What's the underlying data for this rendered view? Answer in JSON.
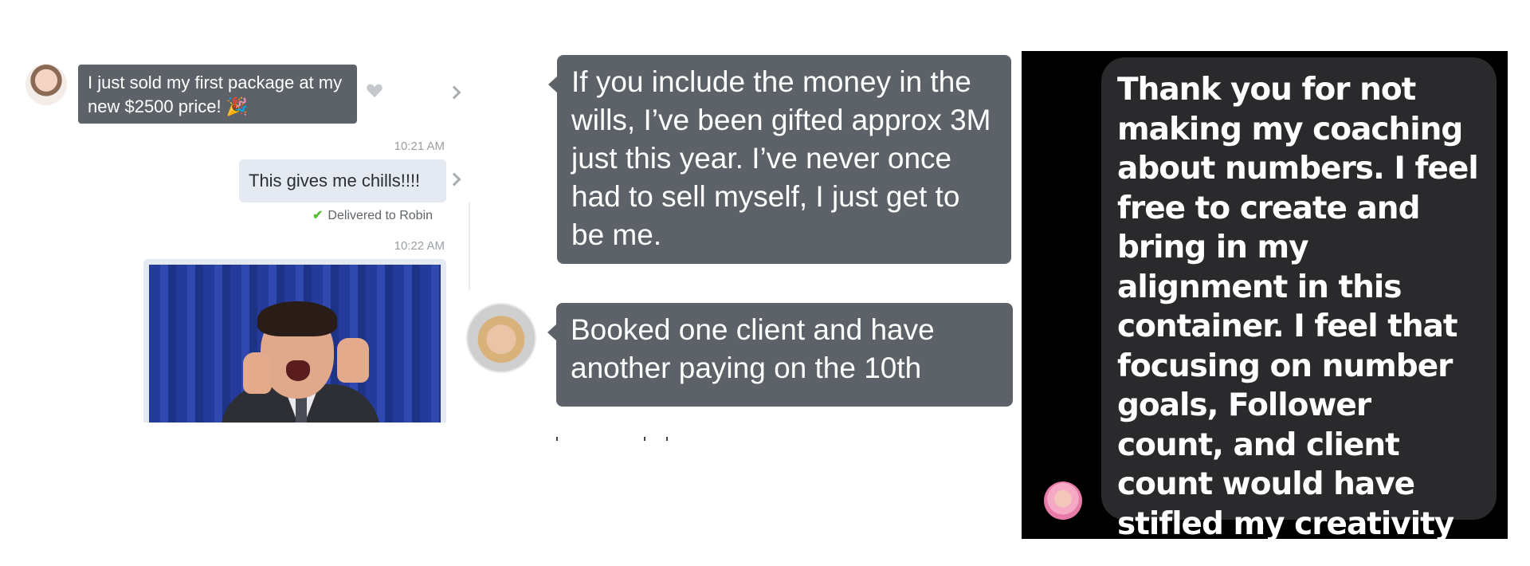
{
  "left_chat": {
    "incoming_message": "I just sold my first package at my new $2500 price! 🎉",
    "time_1": "10:21 AM",
    "outgoing_message": "This gives me chills!!!!",
    "delivered_status": "Delivered to Robin",
    "time_2": "10:22 AM",
    "gif_icon": "celebration-gif"
  },
  "middle_chat": {
    "message_1": "If you include the money in the wills, I’ve been gifted approx 3M just this year. I’ve never once had to sell myself, I just get to be me.",
    "message_2": "Booked one client and have another paying on the 10th"
  },
  "right_chat": {
    "message": "Thank you for not making my coaching about numbers. I feel free to create and bring in my alignment in this container. I feel that focusing on number goals, Follower count, and client count would have stifled my creativity flame out."
  },
  "colors": {
    "dark_bubble": "#5c6267",
    "light_bubble": "#e4e9f2",
    "check_green": "#5cbd3a",
    "black_panel": "#000000",
    "black_bubble": "#2a2a2c"
  }
}
